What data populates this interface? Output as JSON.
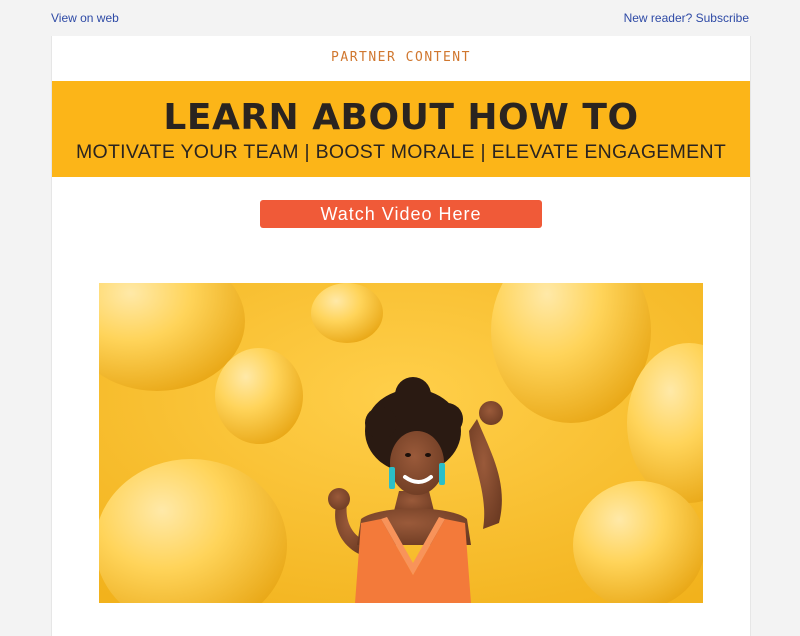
{
  "header": {
    "view_on_web": "View on web",
    "subscribe": "New reader? Subscribe"
  },
  "email": {
    "partner_label": "PARTNER CONTENT",
    "banner_title": "LEARN ABOUT HOW TO",
    "banner_subtitle": "MOTIVATE YOUR TEAM | BOOST MORALE | ELEVATE ENGAGEMENT",
    "cta_label": "Watch Video Here"
  },
  "hero_image": {
    "subject": "woman-with-balloons-photo"
  },
  "colors": {
    "banner_bg": "#fcb518",
    "cta_bg": "#f05a38",
    "partner_text": "#d0772f",
    "link": "#2e4aa6",
    "page_bg": "#f3f3f3"
  }
}
